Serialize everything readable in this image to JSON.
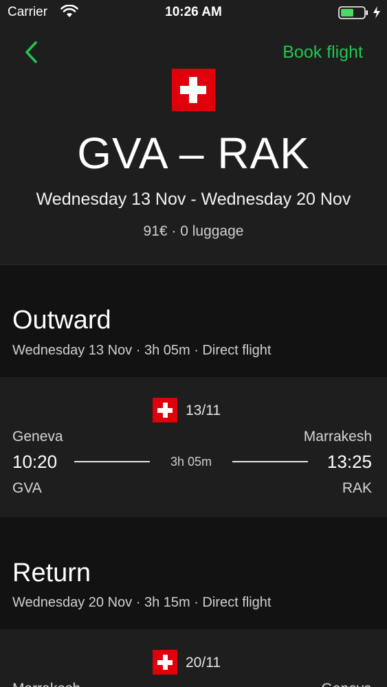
{
  "status_bar": {
    "carrier": "Carrier",
    "time": "10:26 AM"
  },
  "header": {
    "back_icon": "chevron-left-icon",
    "book_label": "Book flight",
    "flag_icon": "swiss-flag-icon",
    "route": "GVA – RAK",
    "dates": "Wednesday 13 Nov - Wednesday 20 Nov",
    "price_info": "91€ · 0 luggage"
  },
  "outward": {
    "title": "Outward",
    "subtitle": "Wednesday 13 Nov · 3h 05m · Direct flight",
    "date": "13/11",
    "from_city": "Geneva",
    "to_city": "Marrakesh",
    "dep_time": "10:20",
    "arr_time": "13:25",
    "duration": "3h 05m",
    "from_code": "GVA",
    "to_code": "RAK"
  },
  "return": {
    "title": "Return",
    "subtitle": "Wednesday 20 Nov · 3h 15m · Direct flight",
    "date": "20/11",
    "from_city": "Marrakesh",
    "to_city": "Geneva"
  },
  "colors": {
    "accent": "#23c552",
    "flag_red": "#e0000b",
    "card_bg": "#1e1e1e",
    "page_bg": "#121212"
  }
}
